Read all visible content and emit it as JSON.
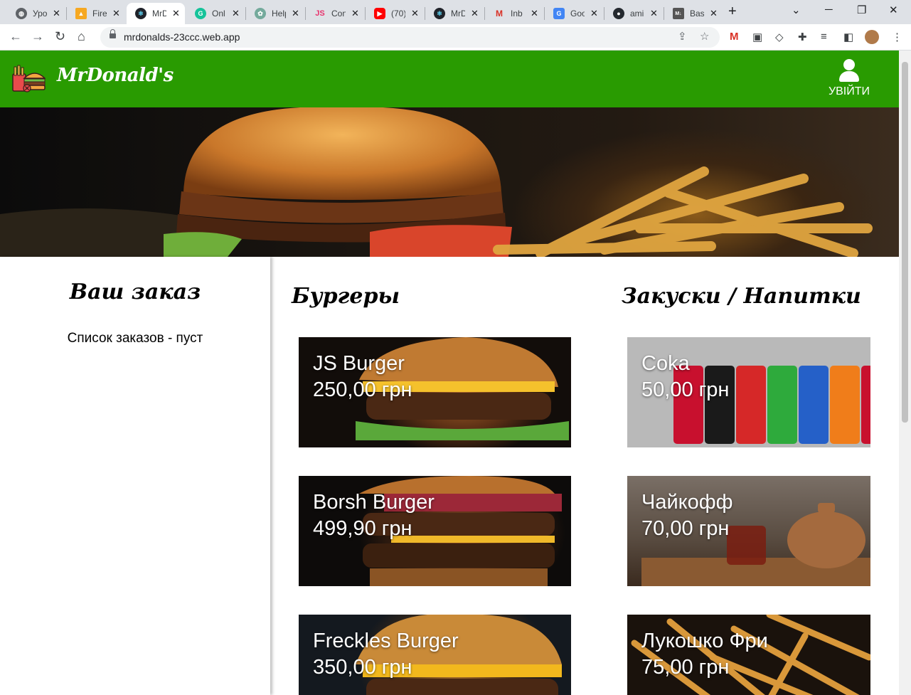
{
  "browser": {
    "tabs": [
      {
        "title": "Уро",
        "icon": "globe-icon",
        "color": "#5f6368"
      },
      {
        "title": "Fire",
        "icon": "firebase-icon",
        "color": "#f6a821"
      },
      {
        "title": "MrD",
        "icon": "react-icon",
        "color": "#20232a",
        "active": true
      },
      {
        "title": "Onl",
        "icon": "grammarly-icon",
        "color": "#15c39a"
      },
      {
        "title": "Help",
        "icon": "openai-icon",
        "color": "#74aa9c"
      },
      {
        "title": "Con",
        "icon": "js-icon",
        "color": "#e8336d"
      },
      {
        "title": "(70)",
        "icon": "youtube-icon",
        "color": "#ff0000"
      },
      {
        "title": "MrD",
        "icon": "react-icon",
        "color": "#20232a"
      },
      {
        "title": "Inb",
        "icon": "gmail-icon",
        "color": "#d93025"
      },
      {
        "title": "Goo",
        "icon": "google-translate-icon",
        "color": "#4285f4"
      },
      {
        "title": "ami",
        "icon": "github-icon",
        "color": "#24292f"
      },
      {
        "title": "Bas",
        "icon": "markdown-icon",
        "color": "#555555"
      }
    ],
    "url": "mrdonalds-23ccc.web.app"
  },
  "header": {
    "logo_text": "MrDonald's",
    "login_label": "УВІЙТИ",
    "brand_color": "#299b01"
  },
  "order": {
    "title": "Ваш заказ",
    "empty_text": "Список заказов - пуст"
  },
  "sections": {
    "burgers_title": "Бургеры",
    "snacks_title": "Закуски / Напитки"
  },
  "burgers": [
    {
      "name": "JS Burger",
      "price": "250,00 грн"
    },
    {
      "name": "Borsh Burger",
      "price": "499,90 грн"
    },
    {
      "name": "Freckles Burger",
      "price": "350,00 грн"
    }
  ],
  "snacks": [
    {
      "name": "Coka",
      "price": "50,00 грн"
    },
    {
      "name": "Чайкофф",
      "price": "70,00 грн"
    },
    {
      "name": "Лукошко Фри",
      "price": "75,00 грн"
    }
  ]
}
